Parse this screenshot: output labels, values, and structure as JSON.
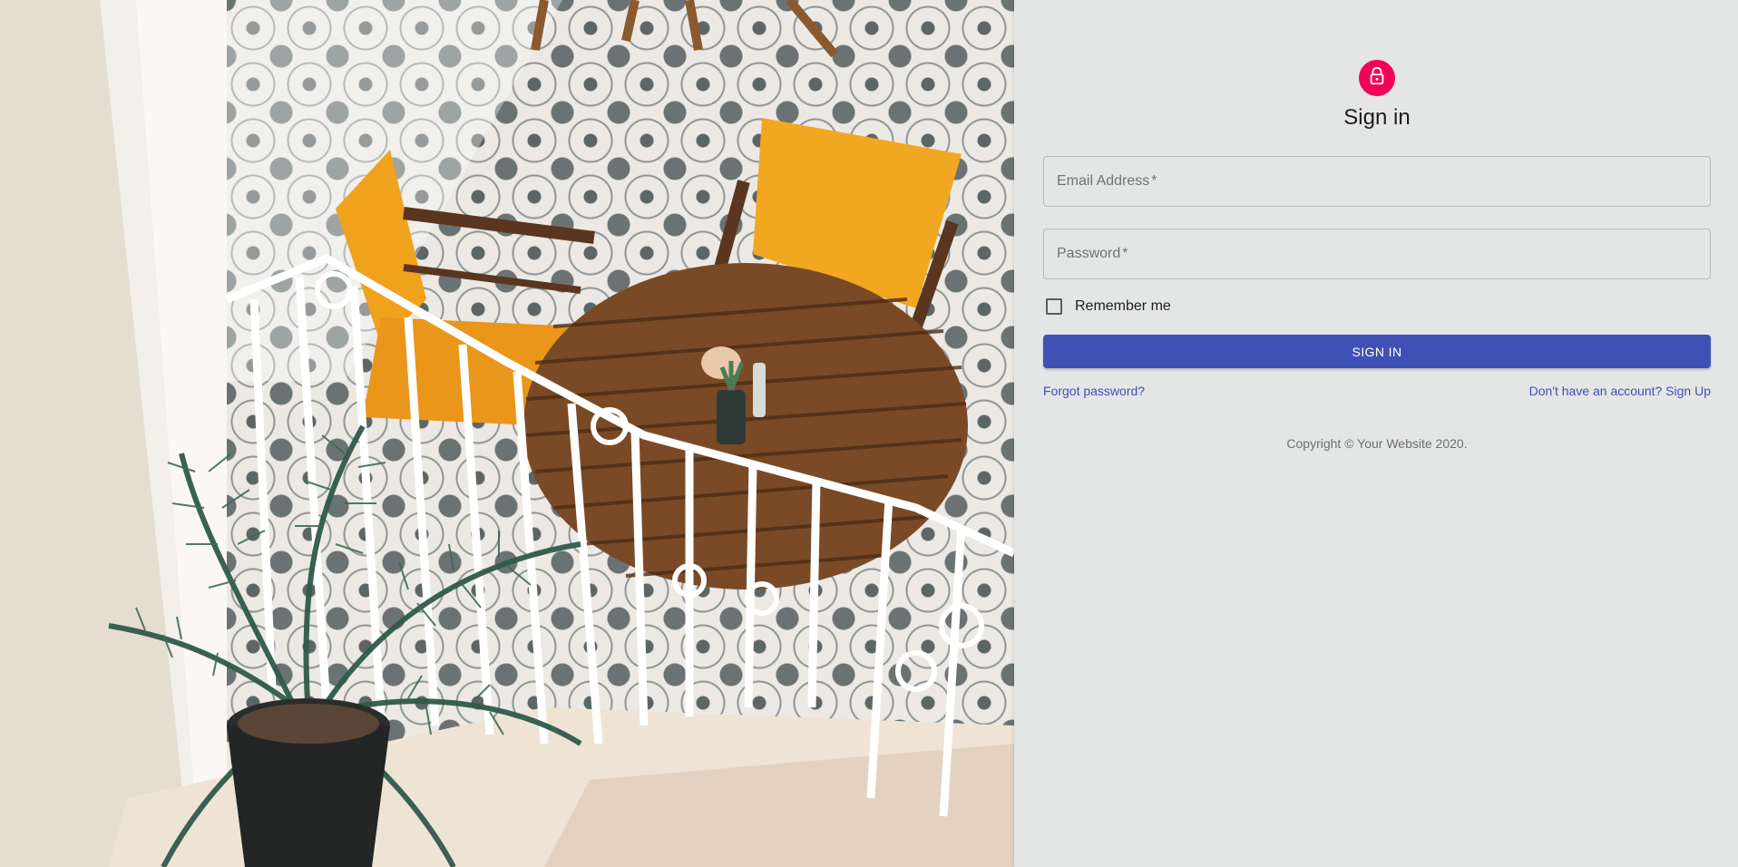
{
  "form": {
    "title": "Sign in",
    "email_label": "Email Address",
    "password_label": "Password",
    "required_mark": "*",
    "remember_label": "Remember me",
    "remember_checked": false,
    "submit_label": "SIGN IN",
    "forgot_link": "Forgot password?",
    "signup_link": "Don't have an account? Sign Up",
    "copyright": "Copyright © Your Website 2020."
  },
  "icons": {
    "avatar": "lock-icon"
  },
  "colors": {
    "accent": "#f50057",
    "primary": "#3f51b5",
    "panel_background": "#e4e5e5"
  }
}
